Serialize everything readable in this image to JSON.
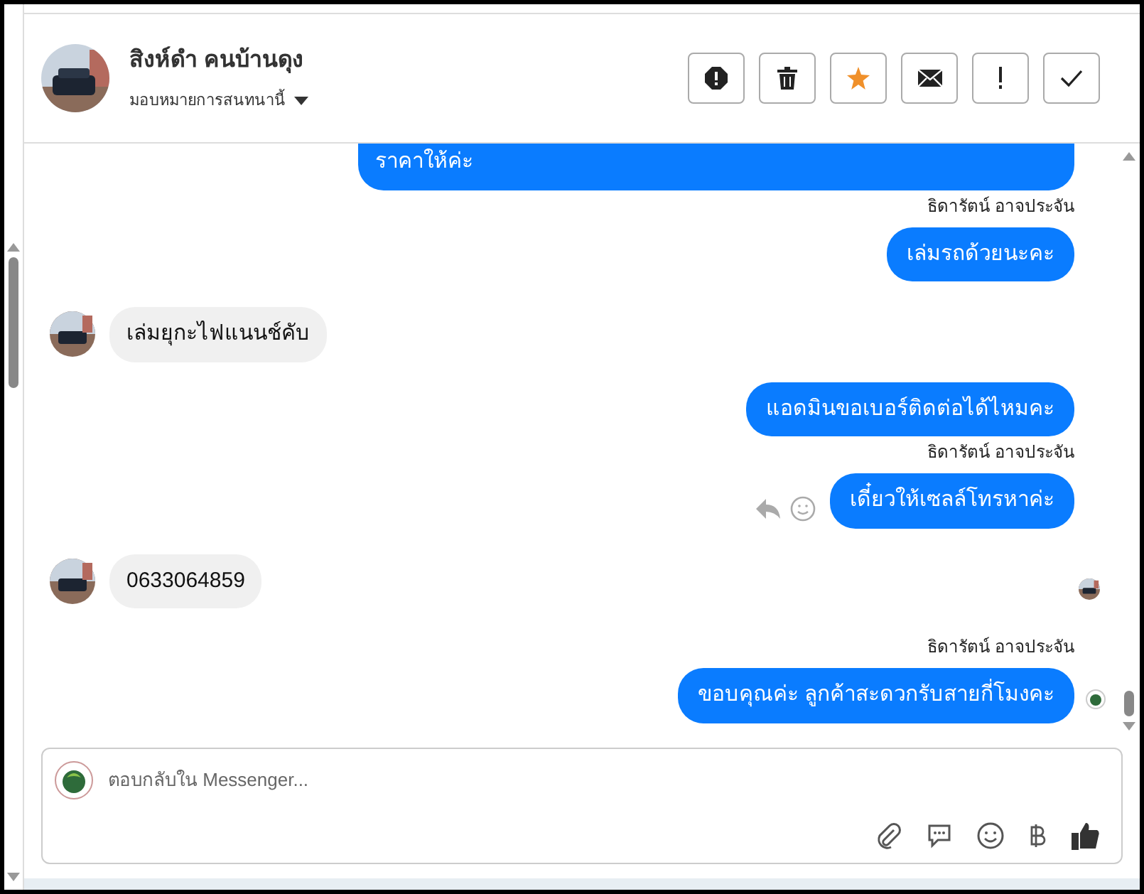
{
  "header": {
    "name": "สิงห์ดำ คนบ้านดุง",
    "assign": "มอบหมายการสนทนานี้"
  },
  "toolbar": [
    {
      "kind": "alert"
    },
    {
      "kind": "trash"
    },
    {
      "kind": "star",
      "selected": true
    },
    {
      "kind": "mail"
    },
    {
      "kind": "bang"
    },
    {
      "kind": "check"
    }
  ],
  "messages": [
    {
      "kind": "sent",
      "text": "ราคาให้ค่ะ",
      "clipped": true
    },
    {
      "kind": "sender",
      "text": "ธิดารัตน์ อาจประจัน"
    },
    {
      "kind": "sent",
      "text": "เล่มรถด้วยนะคะ"
    },
    {
      "kind": "received",
      "text": "เล่มยุกะไฟแนนช์คับ"
    },
    {
      "kind": "sent",
      "text": "แอดมินขอเบอร์ติดต่อได้ไหมคะ"
    },
    {
      "kind": "sender",
      "text": "ธิดารัตน์ อาจประจัน"
    },
    {
      "kind": "sent",
      "text": "เดี๋ยวให้เซลล์โทรหาค่ะ",
      "actions": true
    },
    {
      "kind": "received",
      "text": "0633064859",
      "seen": true
    },
    {
      "kind": "sender",
      "text": "ธิดารัตน์ อาจประจัน"
    },
    {
      "kind": "sent",
      "text": "ขอบคุณค่ะ ลูกค้าสะดวกรับสายกี่โมงคะ",
      "seen": true
    }
  ],
  "composer": {
    "placeholder": "ตอบกลับใน Messenger..."
  }
}
